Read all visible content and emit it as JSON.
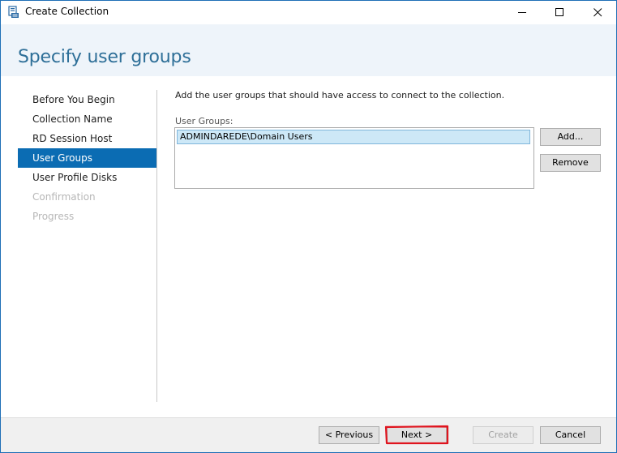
{
  "window": {
    "title": "Create Collection",
    "icon": "server-manager-icon",
    "controls": [
      "minimize-icon",
      "maximize-icon",
      "close-icon"
    ]
  },
  "header": {
    "title": "Specify user groups"
  },
  "sidebar": {
    "items": [
      {
        "label": "Before You Begin",
        "state": "normal"
      },
      {
        "label": "Collection Name",
        "state": "normal"
      },
      {
        "label": "RD Session Host",
        "state": "normal"
      },
      {
        "label": "User Groups",
        "state": "active"
      },
      {
        "label": "User Profile Disks",
        "state": "normal"
      },
      {
        "label": "Confirmation",
        "state": "disabled"
      },
      {
        "label": "Progress",
        "state": "disabled"
      }
    ]
  },
  "main": {
    "instruction": "Add the user groups that should have access to connect to the collection.",
    "groups_label": "User Groups:",
    "groups": [
      "ADMINDAREDE\\Domain Users"
    ],
    "add_label": "Add...",
    "remove_label": "Remove"
  },
  "footer": {
    "previous_label": "< Previous",
    "next_label": "Next >",
    "create_label": "Create",
    "cancel_label": "Cancel"
  },
  "colors": {
    "accent": "#0b6cb3",
    "title": "#2e6f98",
    "annotation": "#e0141e"
  }
}
